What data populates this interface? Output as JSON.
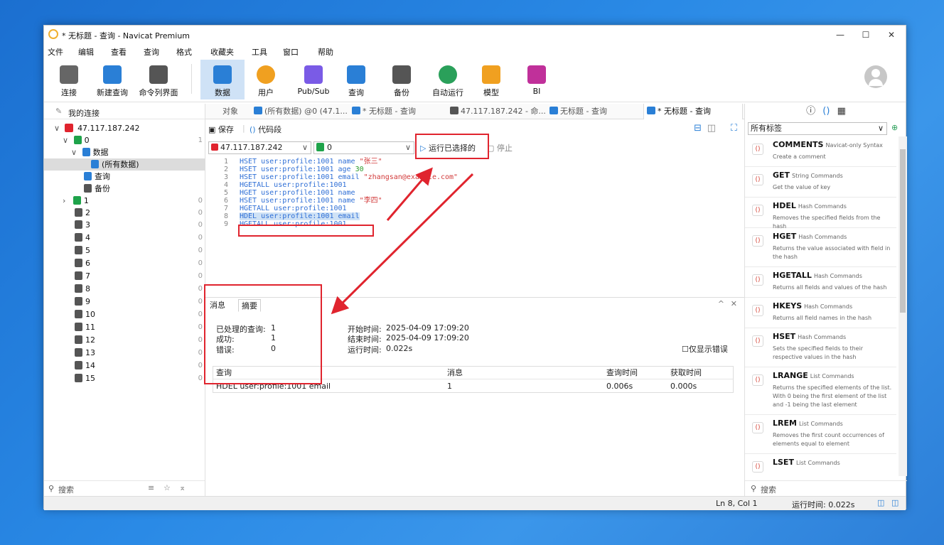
{
  "window": {
    "title": "* 无标题 - 查询 - Navicat Premium",
    "min": "—",
    "max": "☐",
    "close": "✕"
  },
  "menu": [
    "文件",
    "编辑",
    "查看",
    "查询",
    "格式",
    "收藏夹",
    "工具",
    "窗口",
    "帮助"
  ],
  "toolbar": [
    {
      "label": "连接",
      "icon": "plug-icon",
      "color": "#555555"
    },
    {
      "label": "新建查询",
      "icon": "new-query-icon",
      "color": "#2a7fd6"
    },
    {
      "label": "命令列界面",
      "icon": "terminal-icon",
      "color": "#555555"
    },
    {
      "label": "数据",
      "icon": "table-icon",
      "color": "#2a7fd6"
    },
    {
      "label": "用户",
      "icon": "user-icon",
      "color": "#f0a020"
    },
    {
      "label": "Pub/Sub",
      "icon": "broadcast-icon",
      "color": "#7a5be6"
    },
    {
      "label": "查询",
      "icon": "query-icon",
      "color": "#2a7fd6"
    },
    {
      "label": "备份",
      "icon": "backup-icon",
      "color": "#555555"
    },
    {
      "label": "自动运行",
      "icon": "robot-icon",
      "color": "#2aa05a"
    },
    {
      "label": "模型",
      "icon": "model-icon",
      "color": "#f0a020"
    },
    {
      "label": "BI",
      "icon": "bi-icon",
      "color": "#c0309a"
    }
  ],
  "sidebar": {
    "header": "我的连接",
    "connection": "47.117.187.242",
    "db0": {
      "name": "0",
      "count": "1"
    },
    "data_folder": "数据",
    "all_data": "(所有数据)",
    "query": "查询",
    "backup": "备份",
    "dbs": [
      {
        "name": "1",
        "count": "0"
      },
      {
        "name": "2",
        "count": "0"
      },
      {
        "name": "3",
        "count": "0"
      },
      {
        "name": "4",
        "count": "0"
      },
      {
        "name": "5",
        "count": "0"
      },
      {
        "name": "6",
        "count": "0"
      },
      {
        "name": "7",
        "count": "0"
      },
      {
        "name": "8",
        "count": "0"
      },
      {
        "name": "9",
        "count": "0"
      },
      {
        "name": "10",
        "count": "0"
      },
      {
        "name": "11",
        "count": "0"
      },
      {
        "name": "12",
        "count": "0"
      },
      {
        "name": "13",
        "count": "0"
      },
      {
        "name": "14",
        "count": "0"
      },
      {
        "name": "15",
        "count": "0"
      }
    ],
    "search": "搜索"
  },
  "tabs": [
    "对象",
    "(所有数据) @0 (47.1...",
    "* 无标题 - 查询",
    "47.117.187.242 - 命...",
    "无标题 - 查询",
    "* 无标题 - 查询"
  ],
  "editor": {
    "save": "保存",
    "snippet": "代码段",
    "connection": "47.117.187.242",
    "database": "0",
    "run_selected": "运行已选择的",
    "stop": "停止"
  },
  "code": [
    {
      "n": "1",
      "cmd": "HSET",
      "rest": " user:profile:1001 name ",
      "val": "\"张三\"",
      "type": "str"
    },
    {
      "n": "2",
      "cmd": "HSET",
      "rest": " user:profile:1001 age ",
      "val": "30",
      "type": "num"
    },
    {
      "n": "3",
      "cmd": "HSET",
      "rest": " user:profile:1001 email ",
      "val": "\"zhangsan@example.com\"",
      "type": "str"
    },
    {
      "n": "4",
      "cmd": "HGETALL",
      "rest": " user:profile:1001",
      "val": "",
      "type": ""
    },
    {
      "n": "5",
      "cmd": "HGET",
      "rest": " user:profile:1001 name",
      "val": "",
      "type": ""
    },
    {
      "n": "6",
      "cmd": "HSET",
      "rest": " user:profile:1001 name ",
      "val": "\"李四\"",
      "type": "str"
    },
    {
      "n": "7",
      "cmd": "HGETALL",
      "rest": " user:profile:1001",
      "val": "",
      "type": ""
    },
    {
      "n": "8",
      "cmd": "HDEL",
      "rest": " user:profile:1001 email",
      "val": "",
      "type": "",
      "selected": true
    },
    {
      "n": "9",
      "cmd": "HGETALL",
      "rest": " user:profile:1001",
      "val": "",
      "type": ""
    }
  ],
  "result": {
    "tab_message": "消息",
    "tab_summary": "摘要",
    "processed_label": "已处理的查询:",
    "processed": "1",
    "success_label": "成功:",
    "success": "1",
    "error_label": "错误:",
    "error": "0",
    "start_label": "开始时间:",
    "start": "2025-04-09 17:09:20",
    "end_label": "结束时间:",
    "end": "2025-04-09 17:09:20",
    "elapsed_label": "运行时间:",
    "elapsed": "0.022s",
    "only_errors": "仅显示错误",
    "columns": [
      "查询",
      "消息",
      "查询时间",
      "获取时间"
    ],
    "row": [
      "HDEL user:profile:1001 email",
      "1",
      "0.006s",
      "0.000s"
    ]
  },
  "right": {
    "tag_select": "所有标签",
    "snippets": [
      {
        "name": "COMMENTS",
        "cat": "Navicat-only Syntax",
        "desc": "Create a comment"
      },
      {
        "name": "GET",
        "cat": "String Commands",
        "desc": "Get the value of key"
      },
      {
        "name": "HDEL",
        "cat": "Hash Commands",
        "desc": "Removes the specified fields from the hash"
      },
      {
        "name": "HGET",
        "cat": "Hash Commands",
        "desc": "Returns the value associated with field in the hash"
      },
      {
        "name": "HGETALL",
        "cat": "Hash Commands",
        "desc": "Returns all fields and values of the hash"
      },
      {
        "name": "HKEYS",
        "cat": "Hash Commands",
        "desc": "Returns all field names in the hash"
      },
      {
        "name": "HSET",
        "cat": "Hash Commands",
        "desc": "Sets the specified fields to their respective values in the hash"
      },
      {
        "name": "LRANGE",
        "cat": "List Commands",
        "desc": "Returns the specified elements of the list. With 0 being the first element of the list and -1 being the last element"
      },
      {
        "name": "LREM",
        "cat": "List Commands",
        "desc": "Removes the first count occurrences of elements equal to element"
      },
      {
        "name": "LSET",
        "cat": "List Commands",
        "desc": ""
      }
    ],
    "search": "搜索"
  },
  "status": {
    "position": "Ln 8, Col 1",
    "elapsed": "运行时间: 0.022s"
  },
  "colors": {
    "accent": "#2a7fd6",
    "annotation": "#e0242e",
    "selection": "#cfe2f6"
  }
}
